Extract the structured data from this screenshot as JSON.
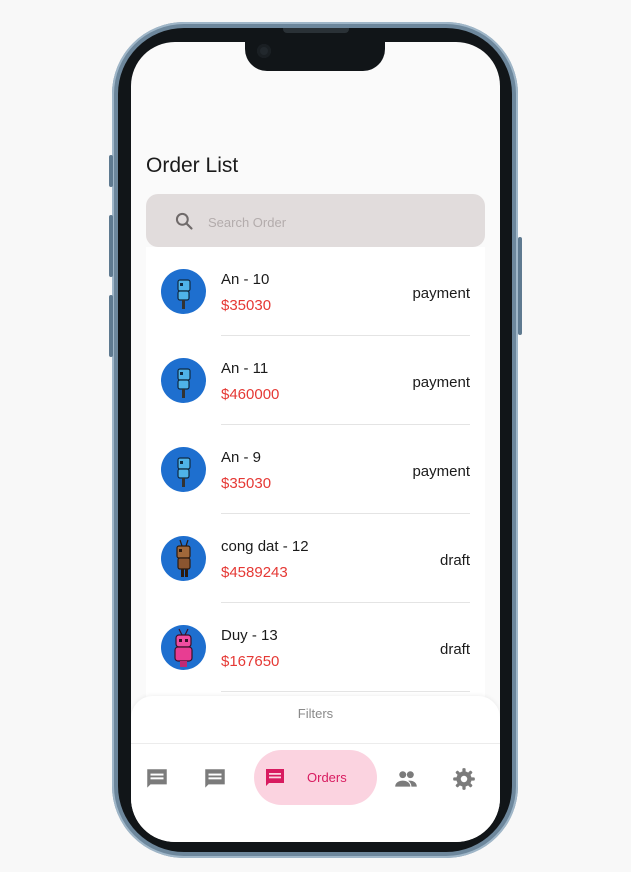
{
  "page": {
    "title": "Order List"
  },
  "search": {
    "placeholder": "Search Order",
    "icon": "search-icon"
  },
  "orders": [
    {
      "name": "An - 10",
      "price": "$35030",
      "status": "payment",
      "avatar": "blue-robot-avatar"
    },
    {
      "name": "An - 11",
      "price": "$460000",
      "status": "payment",
      "avatar": "blue-robot-avatar"
    },
    {
      "name": "An - 9",
      "price": "$35030",
      "status": "payment",
      "avatar": "blue-robot-avatar"
    },
    {
      "name": "cong dat - 12",
      "price": "$4589243",
      "status": "draft",
      "avatar": "brown-robot-avatar"
    },
    {
      "name": "Duy - 13",
      "price": "$167650",
      "status": "draft",
      "avatar": "pink-robot-avatar"
    }
  ],
  "filters": {
    "label": "Filters"
  },
  "bottom_nav": {
    "items": [
      {
        "icon": "chat-icon",
        "active": false
      },
      {
        "icon": "chat-icon",
        "active": false
      },
      {
        "icon": "chat-icon",
        "label": "Orders",
        "active": true
      },
      {
        "icon": "people-icon",
        "active": false
      },
      {
        "icon": "gear-icon",
        "active": false
      }
    ]
  },
  "colors": {
    "price": "#e53935",
    "active_nav_bg": "#fbd3e0",
    "active_nav_fg": "#d81b60",
    "search_bg": "#e1dcdc",
    "avatar_bg": "#1e6fcf"
  }
}
